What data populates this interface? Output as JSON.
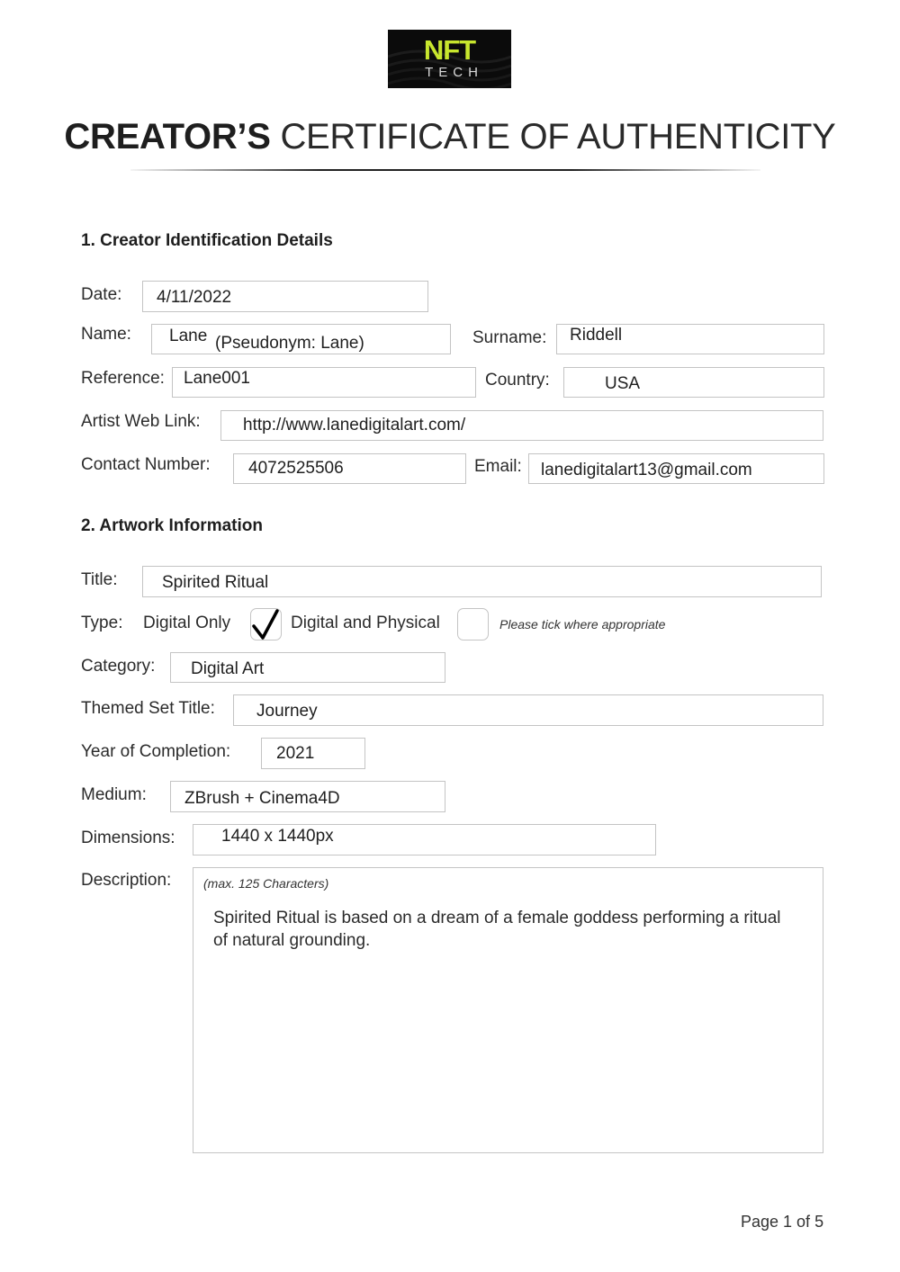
{
  "logo": {
    "line1": "NFT",
    "line2": "TECH",
    "accent_color": "#c8e62e",
    "background_color": "#0b0b0b"
  },
  "header": {
    "title_bold": "CREATOR’S",
    "title_light": "CERTIFICATE OF AUTHENTICITY"
  },
  "section1": {
    "heading": "1. Creator Identification Details",
    "date": {
      "label": "Date:",
      "value": "4/11/2022"
    },
    "name": {
      "label": "Name:",
      "value": "Lane",
      "pseudonym": "(Pseudonym: Lane)"
    },
    "surname": {
      "label": "Surname:",
      "value": "Riddell"
    },
    "reference": {
      "label": "Reference:",
      "value": "Lane001"
    },
    "country": {
      "label": "Country:",
      "value": "USA"
    },
    "web_link": {
      "label": "Artist Web Link:",
      "value": "http://www.lanedigitalart.com/"
    },
    "contact": {
      "label": "Contact Number:",
      "value": "4072525506"
    },
    "email": {
      "label": "Email:",
      "value": "lanedigitalart13@gmail.com"
    }
  },
  "section2": {
    "heading": "2. Artwork Information",
    "title": {
      "label": "Title:",
      "value": "Spirited Ritual"
    },
    "type": {
      "label": "Type:",
      "options": [
        {
          "label": "Digital Only",
          "checked": true
        },
        {
          "label": "Digital and Physical",
          "checked": false
        }
      ],
      "note": "Please tick where appropriate"
    },
    "category": {
      "label": "Category:",
      "value": "Digital Art"
    },
    "themed_set": {
      "label": "Themed Set Title:",
      "value": "Journey"
    },
    "year": {
      "label": "Year of Completion:",
      "value": "2021"
    },
    "medium": {
      "label": "Medium:",
      "value": "ZBrush + Cinema4D"
    },
    "dimensions": {
      "label": "Dimensions:",
      "value": "1440 x 1440px"
    },
    "description": {
      "label": "Description:",
      "hint": "(max. 125 Characters)",
      "value": "Spirited Ritual is based on a dream of a female goddess performing a ritual of natural grounding."
    }
  },
  "footer": {
    "page_label": "Page 1 of 5"
  }
}
